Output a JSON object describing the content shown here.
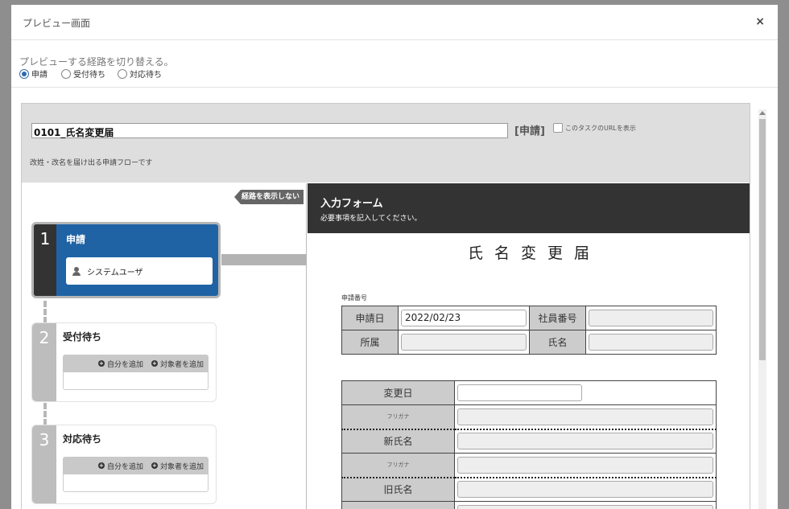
{
  "dialog": {
    "title": "プレビュー画面",
    "close": "×"
  },
  "route_selector": {
    "prompt": "プレビューする経路を切り替える。",
    "options": [
      {
        "label": "申請",
        "selected": true
      },
      {
        "label": "受付待ち",
        "selected": false
      },
      {
        "label": "対応待ち",
        "selected": false
      }
    ]
  },
  "task": {
    "title": "0101_氏名変更届",
    "type": "[申請]",
    "show_url_label": "このタスクのURLを表示",
    "description": "改姓・改名を届け出る申請フローです"
  },
  "flow": {
    "hide_route_label": "経路を表示しない",
    "steps": [
      {
        "number": "1",
        "name": "申請",
        "user": "システムユーザ"
      },
      {
        "number": "2",
        "name": "受付待ち",
        "add_self": "自分を追加",
        "add_target": "対象者を追加"
      },
      {
        "number": "3",
        "name": "対応待ち",
        "add_self": "自分を追加",
        "add_target": "対象者を追加"
      }
    ]
  },
  "form": {
    "header_title": "入力フォーム",
    "header_sub": "必要事項を記入してください。",
    "doc_title": "氏名変更届",
    "application_number_label": "申請番号",
    "table1": {
      "date_label": "申請日",
      "date_value": "2022/02/23",
      "employee_no_label": "社員番号",
      "dept_label": "所属",
      "name_label": "氏名"
    },
    "table2": {
      "change_date_label": "変更日",
      "furigana_label": "フリガナ",
      "new_name_label": "新氏名",
      "old_name_label": "旧氏名"
    }
  },
  "colors": {
    "accent": "#1f63a5",
    "dark": "#333333"
  }
}
